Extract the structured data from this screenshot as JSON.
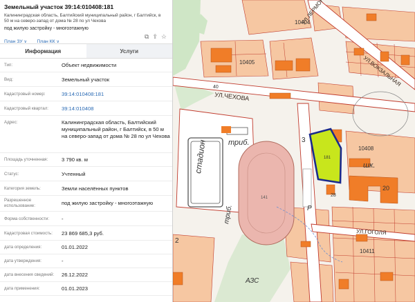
{
  "header": {
    "title": "Земельный участок 39:14:010408:181",
    "address": "Калининградская область, Балтийский муниципальный район, г Балтийск, в 50 м на северо-запад от дома № 28 по ул Чехова",
    "use": "под жилую застройку - многоэтажную",
    "plan_zu": "План ЗУ",
    "plan_kk": "План КК"
  },
  "tabs": {
    "info": "Информация",
    "services": "Услуги"
  },
  "rows": [
    {
      "label": "Тип:",
      "value": "Объект недвижимости"
    },
    {
      "label": "Вид:",
      "value": "Земельный участок"
    },
    {
      "label": "Кадастровый номер:",
      "value": "39:14:010408:181"
    },
    {
      "label": "Кадастровый квартал:",
      "value": "39:14:010408"
    },
    {
      "label": "Адрес:",
      "value": "Калининградская область, Балтийский муниципальный район, г Балтийск, в 50 м на северо-запад от дома № 28 по ул Чехова"
    },
    {
      "label": "Площадь уточненная:",
      "value": "3 790 кв. м"
    },
    {
      "label": "Статус:",
      "value": "Учтенный"
    },
    {
      "label": "Категория земель:",
      "value": "Земли населённых пунктов"
    },
    {
      "label": "Разрешенное использование:",
      "value": "под жилую застройку - многоэтажную"
    },
    {
      "label": "Форма собственности:",
      "value": "-"
    },
    {
      "label": "Кадастровая стоимость:",
      "value": "23 869 685,3 руб."
    },
    {
      "label": "дата определения:",
      "value": "01.01.2022"
    },
    {
      "label": "дата утверждения:",
      "value": "-"
    },
    {
      "label": "дата внесения сведений:",
      "value": "26.12.2022"
    },
    {
      "label": "дата применения:",
      "value": "01.01.2023"
    }
  ],
  "map": {
    "streets": {
      "chekhova": "УЛ.ЧЕХОВА",
      "lermontova": "УЛ.ЛЕРМОНТОВА",
      "vokzalnaya": "УЛ.ВОКЗАЛЬНАЯ",
      "uzkaya": "УЛ.ГОГОЛЯ"
    },
    "labels": {
      "stadium": "стадион",
      "trib1": "триб.",
      "trib2": "триб.",
      "school": "шк.",
      "azs": "АЗС",
      "parking": "Р",
      "q10404": "10404",
      "q10405": "10405",
      "q10408": "10408",
      "q10411": "10411",
      "n20": "20",
      "n28": "28",
      "n3": "3",
      "n2": "2",
      "n40": "40",
      "n141": "141",
      "n181": "181"
    },
    "colors": {
      "parcel_highlight": "#c8e61c",
      "parcel_outline": "#1a2a8c",
      "building": "#f07d28",
      "lot": "#f6c7a2",
      "track": "#ebb6ae",
      "border": "#c0392b"
    }
  }
}
